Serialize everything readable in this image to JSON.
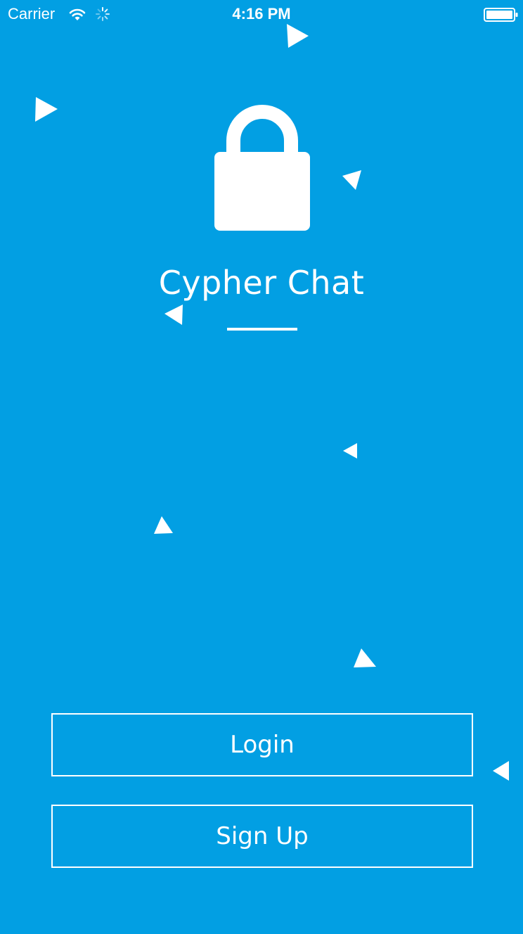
{
  "status_bar": {
    "carrier": "Carrier",
    "time": "4:16 PM",
    "wifi_icon": "wifi-icon",
    "activity_icon": "activity-spinner-icon",
    "battery_icon": "battery-icon"
  },
  "app": {
    "title": "Cypher Chat",
    "logo_icon": "lock-icon"
  },
  "buttons": {
    "login": "Login",
    "signup": "Sign Up"
  },
  "decorations": {
    "particle_icon": "triangle-particle-icon"
  },
  "colors": {
    "background": "#029FE3",
    "foreground": "#FFFFFF"
  }
}
